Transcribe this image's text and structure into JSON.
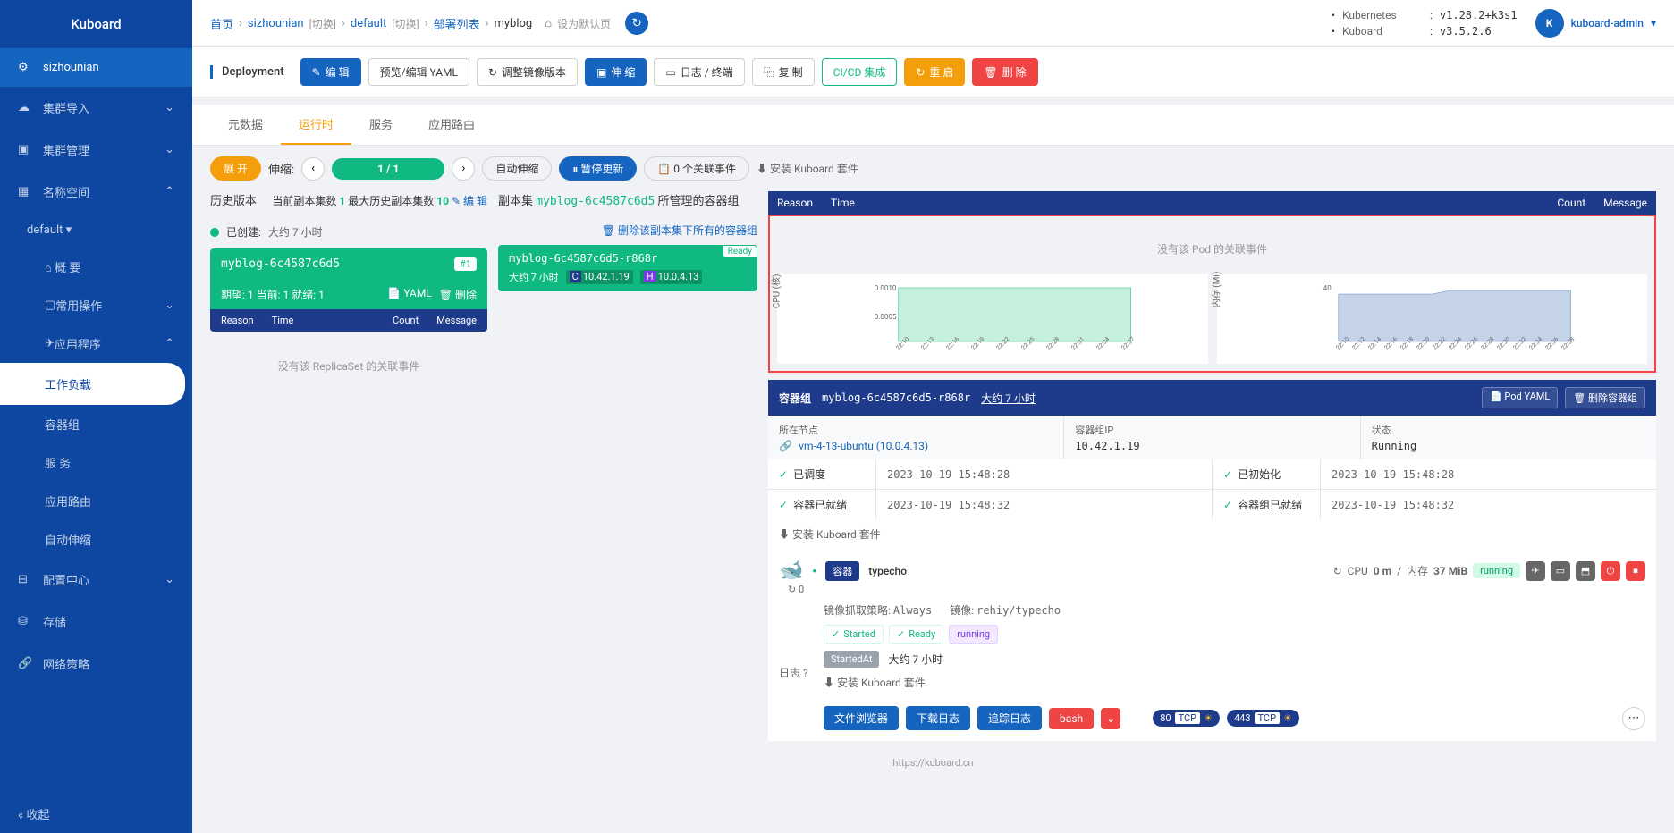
{
  "sidebar": {
    "title": "Kuboard",
    "cluster": "sizhounian",
    "items": [
      {
        "icon": "upload",
        "label": "集群导入"
      },
      {
        "icon": "box",
        "label": "集群管理"
      },
      {
        "icon": "grid",
        "label": "名称空间",
        "expanded": true
      },
      {
        "icon": "send",
        "label": "应用程序",
        "expanded": true
      },
      {
        "icon": "sliders",
        "label": "配置中心"
      },
      {
        "icon": "db",
        "label": "存储"
      },
      {
        "icon": "link",
        "label": "网络策略"
      }
    ],
    "namespace_default": "default ▾",
    "ns_items": [
      "概 要",
      "常用操作"
    ],
    "app_items": [
      "工作负载",
      "容器组",
      "服 务",
      "应用路由",
      "自动伸缩"
    ],
    "collapse": "« 收起"
  },
  "breadcrumb": {
    "home": "首页",
    "cluster": "sizhounian",
    "switch": "[切换]",
    "ns": "default",
    "deploy_list": "部署列表",
    "name": "myblog",
    "set_default": "设为默认页"
  },
  "top_info": {
    "k8s_label": "Kubernetes",
    "k8s_ver": "v1.28.2+k3s1",
    "kb_label": "Kuboard",
    "kb_ver": "v3.5.2.6",
    "user": "kuboard-admin",
    "avatar": "K"
  },
  "actions": {
    "kind": "Deployment",
    "edit": "编 辑",
    "yaml": "预览/编辑 YAML",
    "mirror": "调整镜像版本",
    "scale": "伸 缩",
    "logs": "日志 / 终端",
    "copy": "复 制",
    "cicd": "CI/CD 集成",
    "restart": "重 启",
    "delete": "删 除"
  },
  "tabs": [
    "元数据",
    "运行时",
    "服务",
    "应用路由"
  ],
  "scale_row": {
    "expand": "展 开",
    "scale_label": "伸缩:",
    "replicas": "1 / 1",
    "auto_scale": "自动伸缩",
    "pause": "暂停更新",
    "events": "0 个关联事件",
    "install": "⬇ 安装 Kuboard 套件"
  },
  "history": {
    "title": "历史版本",
    "current_label": "当前副本集数",
    "current": "1",
    "max_label": "最大历史副本集数",
    "max": "10",
    "edit": "编 辑",
    "created_label": "已创建:",
    "created_time": "大约 7 小时",
    "rs_name": "myblog-6c4587c6d5",
    "rs_badge": "#1",
    "rs_desired": "期望: 1 当前: 1 就绪: 1",
    "rs_yaml": "YAML",
    "rs_delete": "删除",
    "reason": "Reason",
    "time": "Time",
    "count": "Count",
    "message": "Message",
    "empty": "没有该 ReplicaSet 的关联事件"
  },
  "replicaset": {
    "prefix": "副本集",
    "name": "myblog-6c4587c6d5",
    "suffix": "所管理的容器组",
    "delete_all": "删除该副本集下所有的容器组",
    "pod_name": "myblog-6c4587c6d5-r868r",
    "ready": "Ready",
    "age": "大约 7 小时",
    "ip_c": "10.42.1.19",
    "ip_h": "10.0.4.13"
  },
  "events": {
    "reason": "Reason",
    "time": "Time",
    "count": "Count",
    "message": "Message",
    "empty": "没有该 Pod 的关联事件"
  },
  "chart_data": [
    {
      "type": "area",
      "title": "",
      "ylabel": "CPU (核)",
      "yticks": [
        0.0005,
        0.001
      ],
      "ylim": [
        0,
        0.0012
      ],
      "categories": [
        "22:10",
        "22:13",
        "22:16",
        "22:19",
        "22:22",
        "22:25",
        "22:28",
        "22:31",
        "22:34",
        "22:37"
      ],
      "values": [
        0.001,
        0.001,
        0.001,
        0.001,
        0.001,
        0.001,
        0.001,
        0.001,
        0.001,
        0.001
      ],
      "color": "#86e3c3"
    },
    {
      "type": "area",
      "title": "",
      "ylabel": "内存 (Mi)",
      "yticks": [
        40
      ],
      "ylim": [
        0,
        50
      ],
      "categories": [
        "22:10",
        "22:12",
        "22:14",
        "22:16",
        "22:18",
        "22:20",
        "22:22",
        "22:24",
        "22:26",
        "22:28",
        "22:30",
        "22:32",
        "22:34",
        "22:36",
        "22:38"
      ],
      "values": [
        36,
        36,
        36,
        36,
        36,
        36,
        37,
        38,
        38,
        38,
        38,
        38,
        38,
        38,
        38
      ],
      "color": "#a5b8d9"
    }
  ],
  "pod_detail": {
    "title": "容器组",
    "name": "myblog-6c4587c6d5-r868r",
    "age": "大约 7 小时",
    "pod_yaml": "Pod YAML",
    "delete_pod": "删除容器组",
    "node_label": "所在节点",
    "node_value": "vm-4-13-ubuntu (10.0.4.13)",
    "podip_label": "容器组IP",
    "podip_value": "10.42.1.19",
    "status_label": "状态",
    "status_value": "Running",
    "scheduled": "已调度",
    "scheduled_ts": "2023-10-19 15:48:28",
    "initialized": "已初始化",
    "initialized_ts": "2023-10-19 15:48:28",
    "ready": "容器已就绪",
    "ready_ts": "2023-10-19 15:48:32",
    "pods_ready": "容器组已就绪",
    "pods_ready_ts": "2023-10-19 15:48:32",
    "install": "⬇ 安装 Kuboard 套件"
  },
  "container": {
    "badge": "容器",
    "name": "typecho",
    "restart_count": "0",
    "cpu_label": "CPU",
    "cpu_val": "0 m",
    "mem_label": "内存",
    "mem_val": "37 MiB",
    "running": "running",
    "pull_label": "镜像抓取策略:",
    "pull_val": "Always",
    "image_label": "镜像:",
    "image_val": "rehiy/typecho",
    "started": "Started",
    "ready_chip": "Ready",
    "running_chip": "running",
    "started_at": "StartedAt",
    "started_time": "大约 7 小时",
    "log_label": "日志",
    "install": "⬇ 安装 Kuboard 套件",
    "file_browser": "文件浏览器",
    "download_log": "下载日志",
    "trace_log": "追踪日志",
    "bash": "bash",
    "port1": "80",
    "port2": "443",
    "tcp": "TCP"
  },
  "footer": "https://kuboard.cn"
}
